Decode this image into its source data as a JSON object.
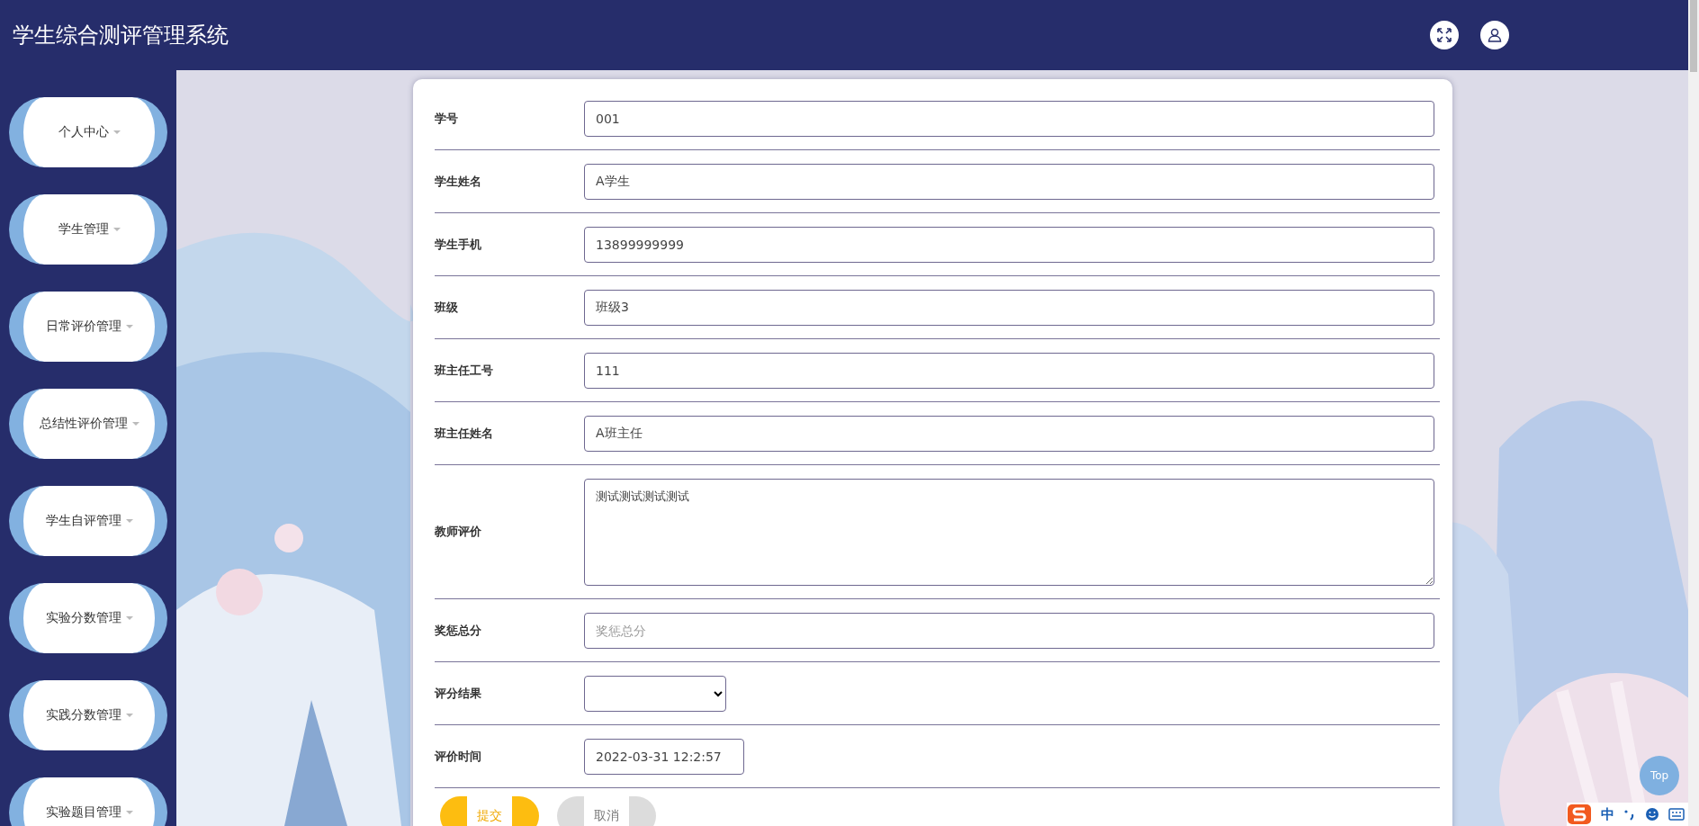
{
  "header": {
    "title": "学生综合测评管理系统"
  },
  "sidebar": {
    "items": [
      {
        "label": "个人中心"
      },
      {
        "label": "学生管理"
      },
      {
        "label": "日常评价管理"
      },
      {
        "label": "总结性评价管理"
      },
      {
        "label": "学生自评管理"
      },
      {
        "label": "实验分数管理"
      },
      {
        "label": "实践分数管理"
      },
      {
        "label": "实验题目管理"
      }
    ]
  },
  "form": {
    "fields": [
      {
        "label": "学号",
        "kind": "text",
        "value": "001"
      },
      {
        "label": "学生姓名",
        "kind": "text",
        "value": "A学生"
      },
      {
        "label": "学生手机",
        "kind": "text",
        "value": "13899999999"
      },
      {
        "label": "班级",
        "kind": "text",
        "value": "班级3"
      },
      {
        "label": "班主任工号",
        "kind": "text",
        "value": "111"
      },
      {
        "label": "班主任姓名",
        "kind": "text",
        "value": "A班主任"
      },
      {
        "label": "教师评价",
        "kind": "textarea",
        "value": "测试测试测试测试"
      },
      {
        "label": "奖惩总分",
        "kind": "text",
        "placeholder": "奖惩总分"
      },
      {
        "label": "评分结果",
        "kind": "select"
      },
      {
        "label": "评价时间",
        "kind": "date",
        "value": "2022-03-31 12:2:57"
      }
    ],
    "buttons": [
      {
        "label": "提交",
        "kind": "primary"
      },
      {
        "label": "取消",
        "kind": "secondary"
      }
    ]
  },
  "top_button": {
    "label": "Top"
  },
  "ime_toolbar": {
    "mode": "中"
  }
}
